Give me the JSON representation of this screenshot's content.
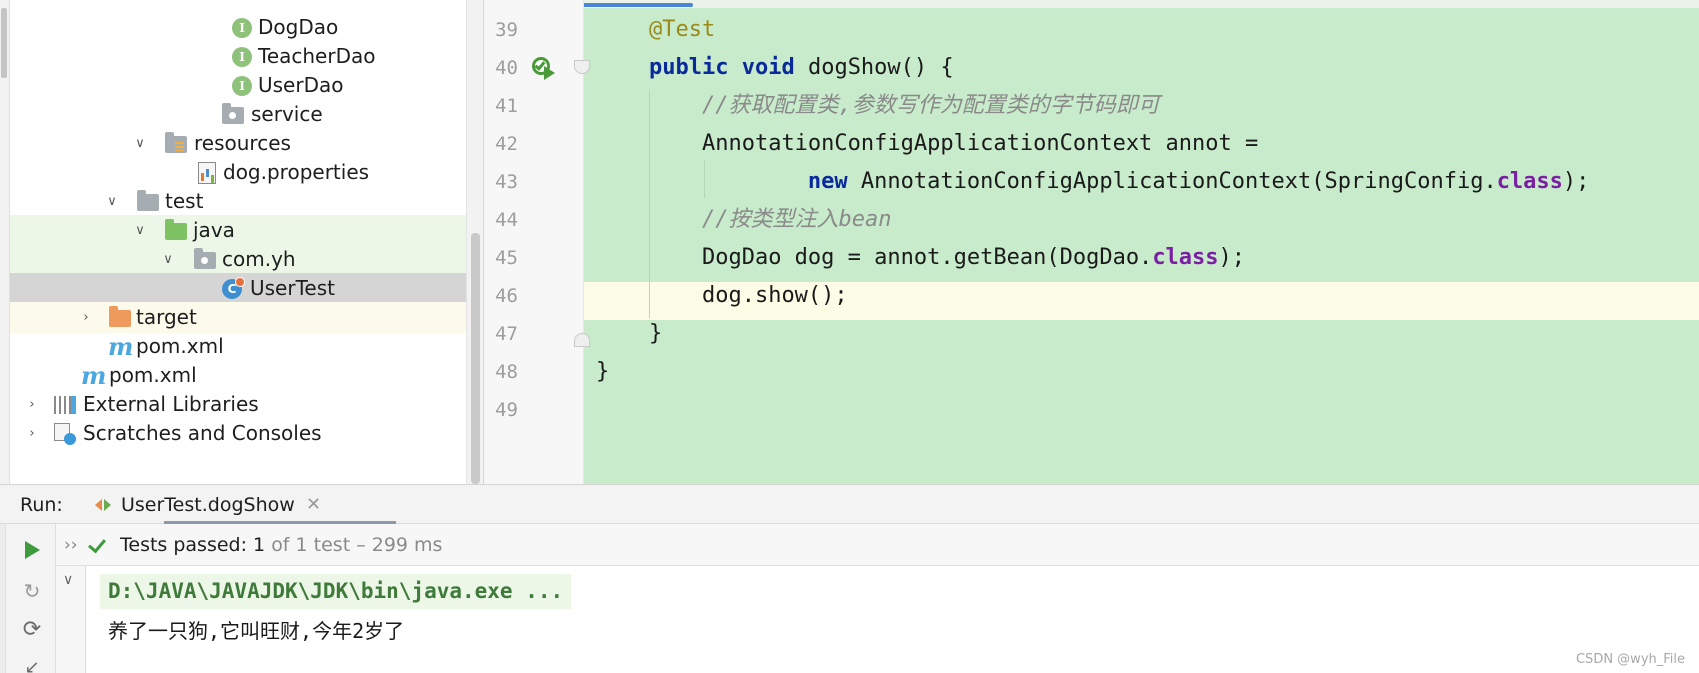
{
  "project_tree": {
    "items": [
      {
        "label": "DogDao",
        "icon": "interface-icon"
      },
      {
        "label": "TeacherDao",
        "icon": "interface-icon"
      },
      {
        "label": "UserDao",
        "icon": "interface-icon"
      },
      {
        "label": "service",
        "icon": "package-folder-icon"
      },
      {
        "label": "resources",
        "icon": "resources-folder-icon"
      },
      {
        "label": "dog.properties",
        "icon": "properties-file-icon"
      },
      {
        "label": "test",
        "icon": "folder-icon"
      },
      {
        "label": "java",
        "icon": "test-source-folder-icon"
      },
      {
        "label": "com.yh",
        "icon": "package-folder-icon"
      },
      {
        "label": "UserTest",
        "icon": "test-class-icon"
      },
      {
        "label": "target",
        "icon": "excluded-folder-icon"
      },
      {
        "label": "pom.xml",
        "icon": "maven-icon"
      },
      {
        "label": "pom.xml",
        "icon": "maven-icon"
      },
      {
        "label": "External Libraries",
        "icon": "libraries-icon"
      },
      {
        "label": "Scratches and Consoles",
        "icon": "scratches-icon"
      }
    ]
  },
  "editor": {
    "line_numbers": [
      "39",
      "40",
      "41",
      "42",
      "43",
      "44",
      "45",
      "46",
      "47",
      "48",
      "49"
    ],
    "lines": [
      {
        "annotation": "@Test"
      },
      {
        "kw1": "public",
        "kw2": "void",
        "text": "dogShow() {"
      },
      {
        "comment": "//获取配置类,参数写作为配置类的字节码即可"
      },
      {
        "text": "AnnotationConfigApplicationContext annot ="
      },
      {
        "kw": "new",
        "text": "AnnotationConfigApplicationContext(SpringConfig.",
        "field": "class",
        "tail": ");"
      },
      {
        "comment": "//按类型注入bean"
      },
      {
        "text": "DogDao dog = annot.getBean(DogDao.",
        "field": "class",
        "tail": ");"
      },
      {
        "text": "dog.show();"
      },
      {
        "text": "}"
      },
      {
        "text": "}"
      },
      {
        "text": ""
      }
    ],
    "current_line": "46",
    "highlight_color": "#c8ebcc"
  },
  "run_panel": {
    "label": "Run:",
    "tab_label": "UserTest.dogShow",
    "tab_close": "✕",
    "status_bold": "Tests passed: 1",
    "status_rest": "of 1 test – 299 ms",
    "command": "D:\\JAVA\\JAVAJDK\\JDK\\bin\\java.exe ...",
    "output": "养了一只狗,它叫旺财,今年2岁了",
    "pass_color": "#3d9a3d"
  },
  "watermark": "CSDN @wyh_File"
}
